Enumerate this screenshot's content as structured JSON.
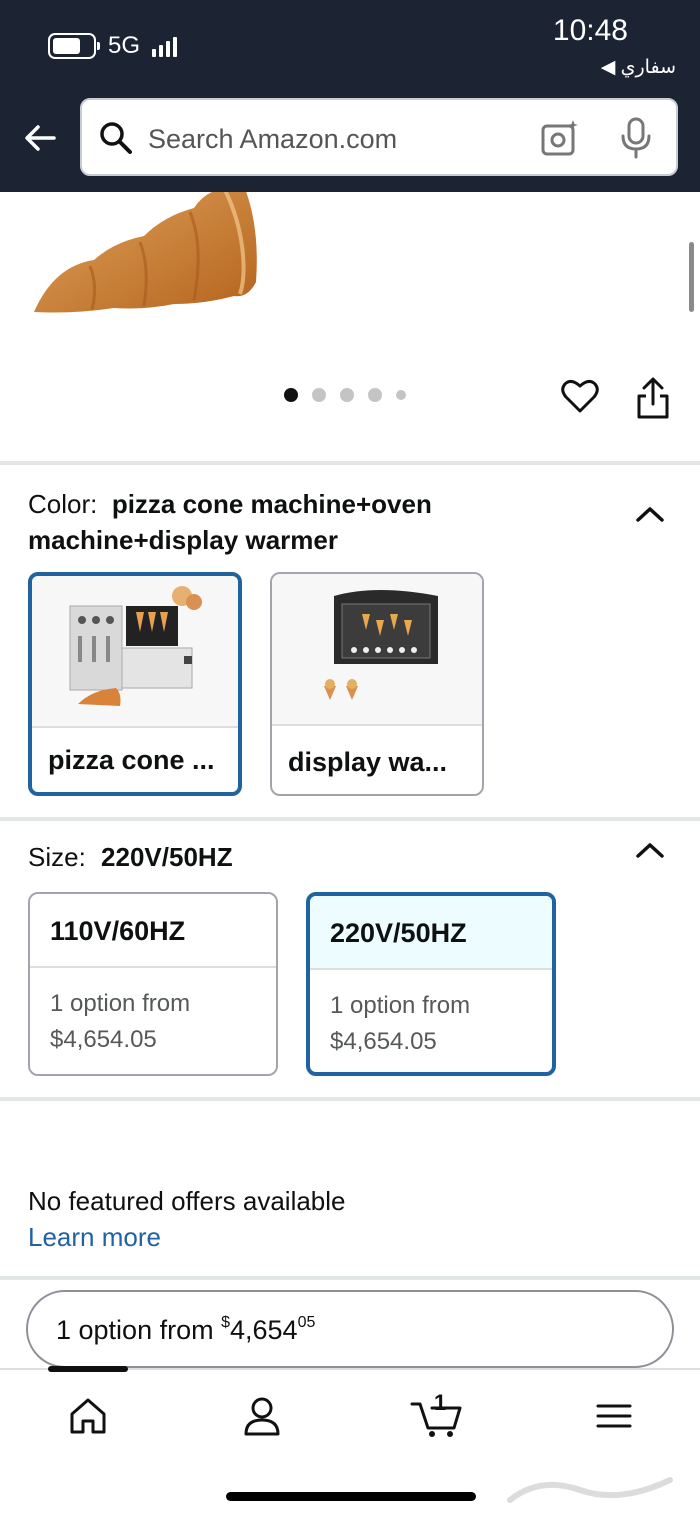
{
  "status_bar": {
    "network": "5G",
    "time": "10:48",
    "back_to_app": "◀ سفاري"
  },
  "search": {
    "placeholder": "Search Amazon.com"
  },
  "gallery": {
    "image_count": 5,
    "active_index": 0
  },
  "color": {
    "label": "Color:",
    "value": "pizza cone machine+oven machine+display warmer",
    "options": [
      {
        "label": "pizza cone ...",
        "selected": true
      },
      {
        "label": "display wa...",
        "selected": false
      }
    ]
  },
  "size": {
    "label": "Size:",
    "value": "220V/50HZ",
    "options": [
      {
        "label": "110V/60HZ",
        "line1": "1 option from",
        "line2": "$4,654.05",
        "selected": false
      },
      {
        "label": "220V/50HZ",
        "line1": "1 option from",
        "line2": "$4,654.05",
        "selected": true
      }
    ]
  },
  "offers": {
    "no_offers_text": "No featured offers available",
    "learn_more": "Learn more"
  },
  "option_pill": {
    "prefix": "1 option from ",
    "currency": "$",
    "whole": "4,654",
    "fraction": "05"
  },
  "bottom_nav": {
    "cart_count": "1",
    "items": [
      "home",
      "account",
      "cart",
      "menu"
    ]
  },
  "colors": {
    "header_bg": "#1c2333",
    "selected_border": "#2162a1",
    "link": "#2162a1"
  }
}
